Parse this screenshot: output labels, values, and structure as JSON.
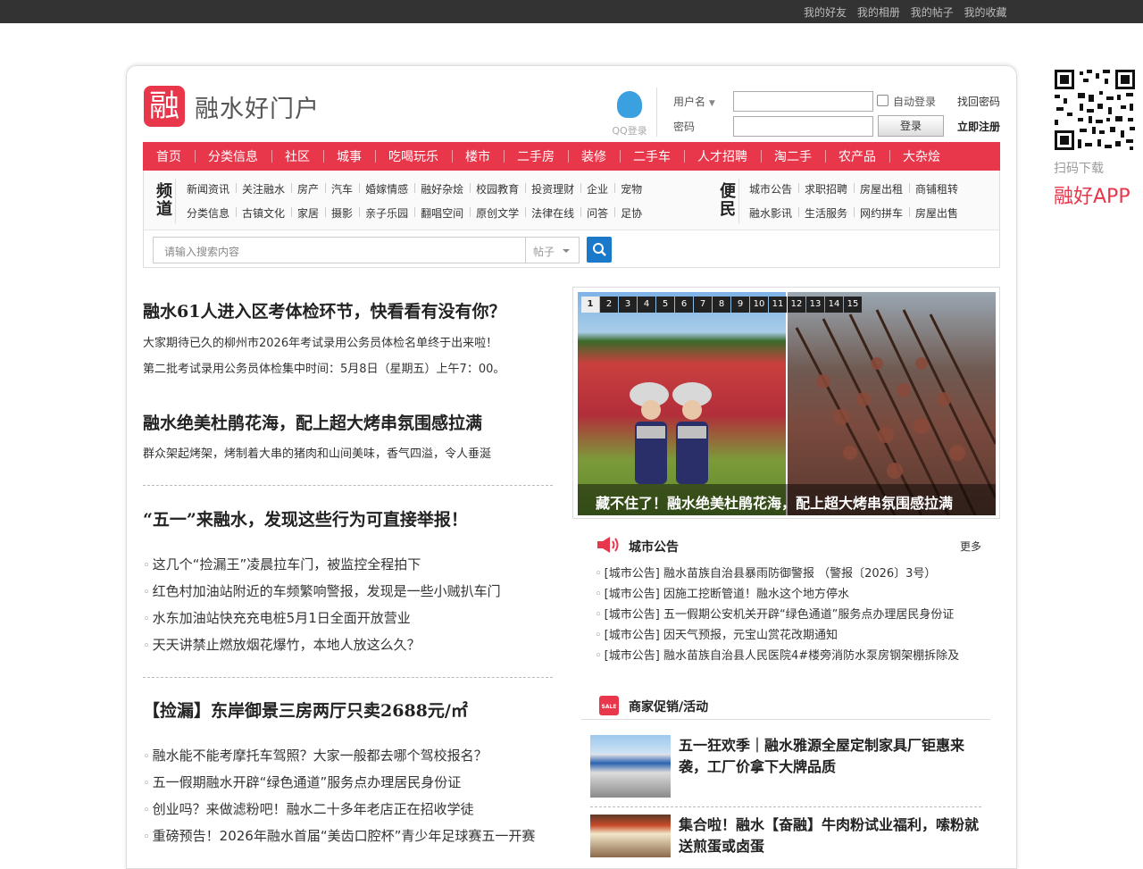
{
  "topbar": {
    "links": [
      "我的好友",
      "我的相册",
      "我的帖子",
      "我的收藏"
    ]
  },
  "header": {
    "logo_char": "融",
    "site_name": "融水好门户",
    "qq_login": "QQ登录",
    "username_label": "用户名",
    "password_label": "密码",
    "auto_login": "自动登录",
    "find_password": "找回密码",
    "login_button": "登录",
    "register": "立即注册"
  },
  "side": {
    "scan_text": "扫码下载",
    "app_text": "融好APP"
  },
  "nav": [
    "首页",
    "分类信息",
    "社区",
    "城事",
    "吃喝玩乐",
    "楼市",
    "二手房",
    "装修",
    "二手车",
    "人才招聘",
    "淘二手",
    "农产品",
    "大杂烩"
  ],
  "channels": {
    "label": "频道",
    "row1": [
      "新闻资讯",
      "关注融水",
      "房产",
      "汽车",
      "婚嫁情感",
      "融好杂烩",
      "校园教育",
      "投资理财",
      "企业",
      "宠物"
    ],
    "row2": [
      "分类信息",
      "古镇文化",
      "家居",
      "摄影",
      "亲子乐园",
      "翻唱空间",
      "原创文学",
      "法律在线",
      "问答",
      "足协"
    ]
  },
  "convenience": {
    "label": "便民",
    "row1": [
      "城市公告",
      "求职招聘",
      "房屋出租",
      "商铺租转"
    ],
    "row2": [
      "融水影讯",
      "生活服务",
      "网约拼车",
      "房屋出售"
    ]
  },
  "search": {
    "placeholder": "请输入搜索内容",
    "type": "帖子"
  },
  "left": {
    "headline1": "融水61人进入区考体检环节，快看看有没有你？",
    "p1a": "大家期待已久的柳州市2026年考试录用公务员体检名单终于出来啦！",
    "p1b": "第二批考试录用公务员体检集中时间：5月8日（星期五）上午7：00。",
    "headline2": "融水绝美杜鹃花海，配上超大烤串氛围感拉满",
    "p2": "群众架起烤架，烤制着大串的猪肉和山间美味，香气四溢，令人垂涎",
    "headline3": "“五一”来融水，发现这些行为可直接举报！",
    "list1": [
      "这几个“捡漏王”凌晨拉车门，被监控全程拍下",
      "红色村加油站附近的车频繁响警报，发现是一些小贼扒车门",
      "水东加油站快充充电桩5月1日全面开放营业",
      "天天讲禁止燃放烟花爆竹，本地人放这么久？"
    ],
    "headline4": "【捡漏】东岸御景三房两厅只卖2688元/㎡",
    "list2": [
      "融水能不能考摩托车驾照？大家一般都去哪个驾校报名？",
      "五一假期融水开辟“绿色通道”服务点办理居民身份证",
      "创业吗？来做滤粉吧！融水二十多年老店正在招收学徒",
      "重磅预告！2026年融水首届“美齿口腔杯”青少年足球赛五一开赛"
    ]
  },
  "slider": {
    "pages": [
      "1",
      "2",
      "3",
      "4",
      "5",
      "6",
      "7",
      "8",
      "9",
      "10",
      "11",
      "12",
      "13",
      "14",
      "15"
    ],
    "active_page": "1",
    "caption": "藏不住了！融水绝美杜鹃花海，配上超大烤串氛围感拉满"
  },
  "notice": {
    "title": "城市公告",
    "more": "更多",
    "items": [
      "[城市公告] 融水苗族自治县暴雨防御警报 （警报〔2026〕3号）",
      "[城市公告] 因施工挖断管道！融水这个地方停水",
      "[城市公告] 五一假期公安机关开辟“绿色通道”服务点办理居民身份证",
      "[城市公告] 因天气预报，元宝山赏花改期通知",
      "[城市公告] 融水苗族自治县人民医院4#楼旁消防水泵房钢架棚拆除及"
    ]
  },
  "promo": {
    "title": "商家促销/活动",
    "sale_badge": "SALE",
    "items": [
      "五一狂欢季｜融水雅源全屋定制家具厂钜惠来袭，工厂价拿下大牌品质",
      "集合啦！融水【奋融】牛肉粉试业福利，嗦粉就送煎蛋或卤蛋"
    ]
  }
}
